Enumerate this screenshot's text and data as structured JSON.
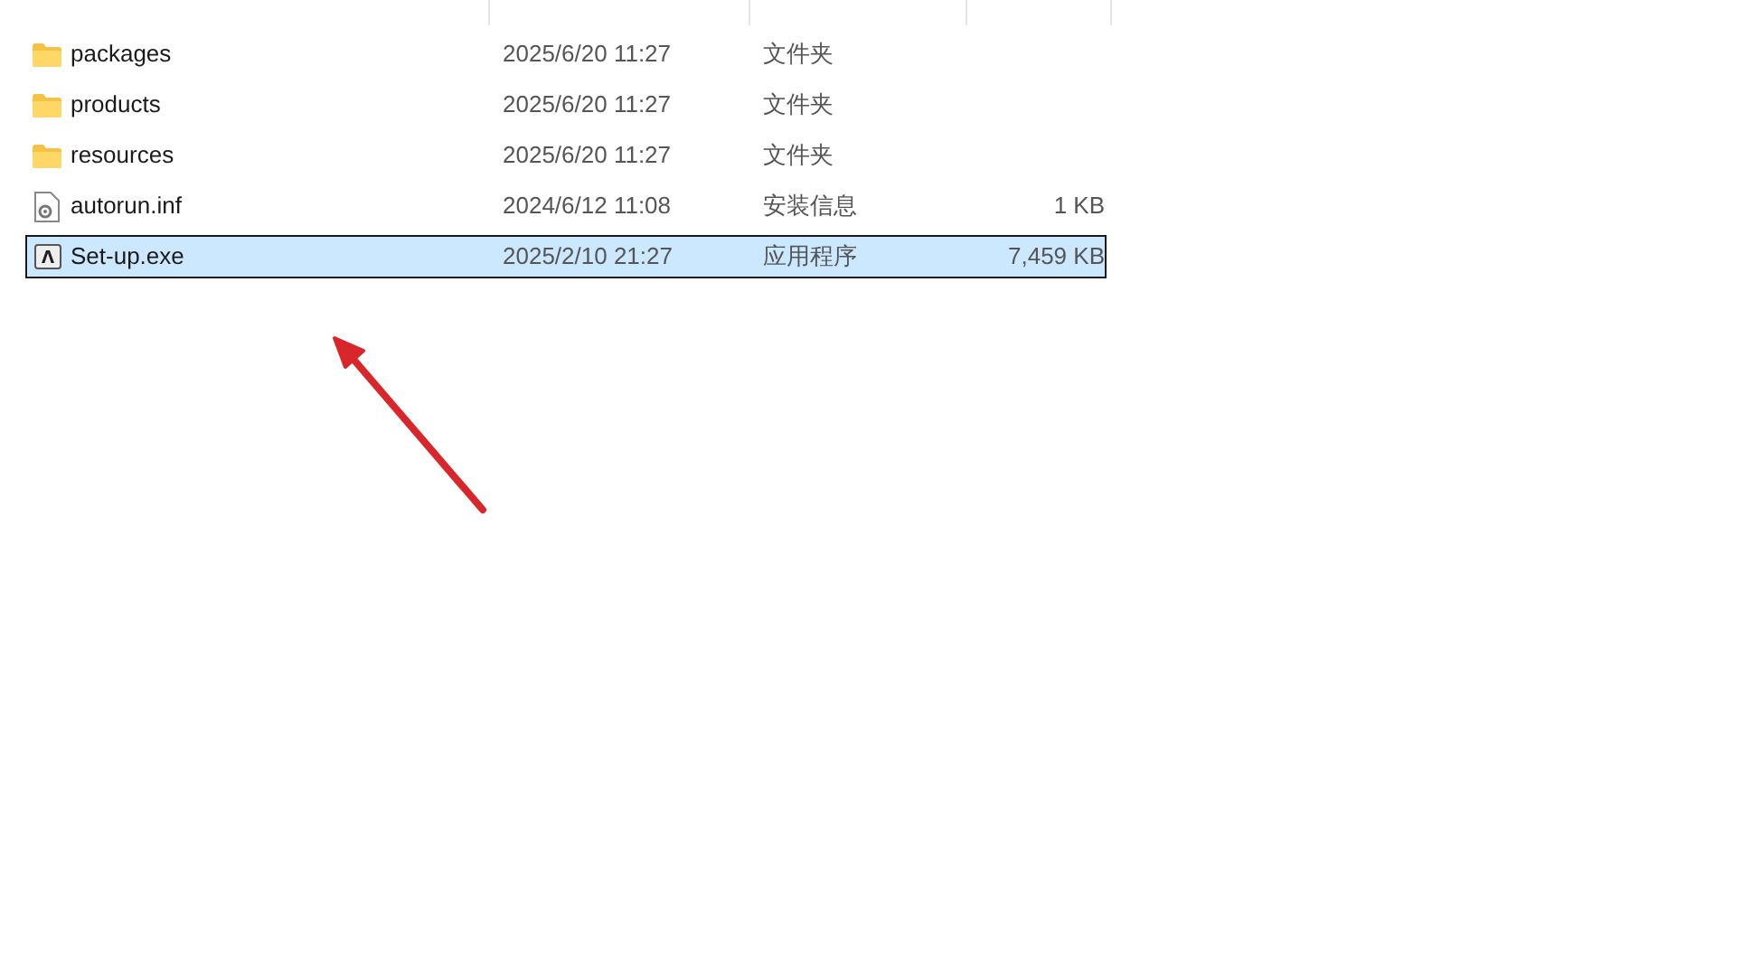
{
  "files": [
    {
      "name": "packages",
      "kind": "folder",
      "modified": "2025/6/20 11:27",
      "type": "文件夹",
      "selected": false
    },
    {
      "name": "products",
      "kind": "folder",
      "modified": "2025/6/20 11:27",
      "type": "文件夹",
      "selected": false
    },
    {
      "name": "resources",
      "kind": "folder",
      "modified": "2025/6/20 11:27",
      "type": "文件夹",
      "selected": false
    },
    {
      "name": "autorun.inf",
      "kind": "settings",
      "modified": "2024/6/12 11:08",
      "type": "安装信息",
      "size": "1 KB",
      "selected": false
    },
    {
      "name": "Set-up.exe",
      "kind": "app",
      "modified": "2025/2/10 21:27",
      "type": "应用程序",
      "size": "7,459 KB",
      "selected": true
    }
  ],
  "annotation": {
    "kind": "arrow",
    "color": "#d9262b"
  }
}
